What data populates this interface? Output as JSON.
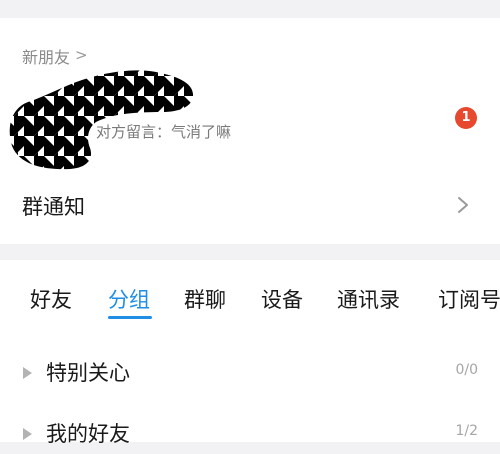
{
  "new_friends": {
    "label": "新朋友",
    "chevron": ">",
    "message": "对方留言：气消了嘛",
    "unread_count": "1",
    "avatar_icon": "houndstooth-avatar"
  },
  "group_notice": {
    "label": "群通知",
    "arrow_icon": "chevron-right-icon"
  },
  "tabs": [
    {
      "label": "好友"
    },
    {
      "label": "分组"
    },
    {
      "label": "群聊"
    },
    {
      "label": "设备"
    },
    {
      "label": "通讯录"
    },
    {
      "label": "订阅号"
    }
  ],
  "active_tab": "分组",
  "groups": [
    {
      "name": "特别关心",
      "count": "0/0"
    },
    {
      "name": "我的好友",
      "count": "1/2"
    }
  ],
  "colors": {
    "accent": "#1f8ee6",
    "badge": "#e6492d",
    "background": "#f2f2f4"
  }
}
